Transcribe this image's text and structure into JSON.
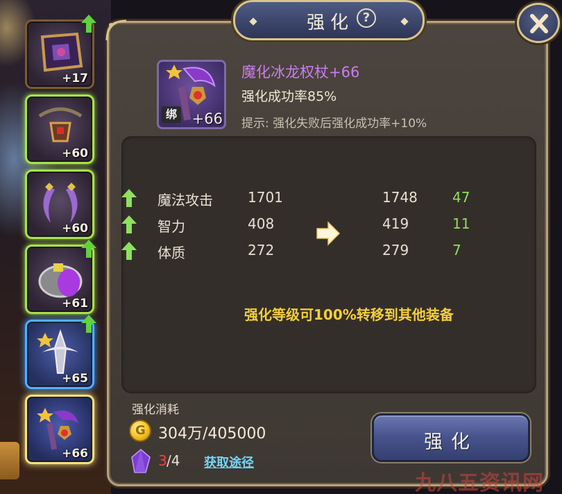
{
  "header": {
    "title": "强化",
    "help_icon": "?",
    "close_icon": "close-icon"
  },
  "equipment_list": [
    {
      "level": "+17",
      "rarity": "purple",
      "upgrade_available": true
    },
    {
      "level": "+60",
      "rarity": "green",
      "upgrade_available": false
    },
    {
      "level": "+60",
      "rarity": "green",
      "upgrade_available": false
    },
    {
      "level": "+61",
      "rarity": "green",
      "upgrade_available": true
    },
    {
      "level": "+65",
      "rarity": "blue",
      "upgrade_available": true
    },
    {
      "level": "+66",
      "rarity": "blue",
      "upgrade_available": false,
      "selected": true
    }
  ],
  "item": {
    "name": "魔化冰龙权杖+66",
    "success_rate_label": "强化成功率85%",
    "hint": "提示: 强化失败后强化成功率+10%",
    "bind_tag": "绑",
    "level": "+66"
  },
  "stats": [
    {
      "name": "魔法攻击",
      "old": "1701",
      "new": "1748",
      "diff": "47"
    },
    {
      "name": "智力",
      "old": "408",
      "new": "419",
      "diff": "11"
    },
    {
      "name": "体质",
      "old": "272",
      "new": "279",
      "diff": "7"
    }
  ],
  "transfer_note": "强化等级可100%转移到其他装备",
  "cost": {
    "label": "强化消耗",
    "coin_letter": "G",
    "gold": "304万/405000",
    "crystal_have": "3",
    "crystal_need": "/4",
    "obtain_link": "获取途径"
  },
  "enhance_button": "强化",
  "watermark": "九八五资讯网",
  "colors": {
    "item_name": "#c97ef0",
    "stat_increase": "#8ee05e",
    "note": "#f3cf3b",
    "insufficient": "#ff3b3b",
    "link": "#74d6f2"
  }
}
